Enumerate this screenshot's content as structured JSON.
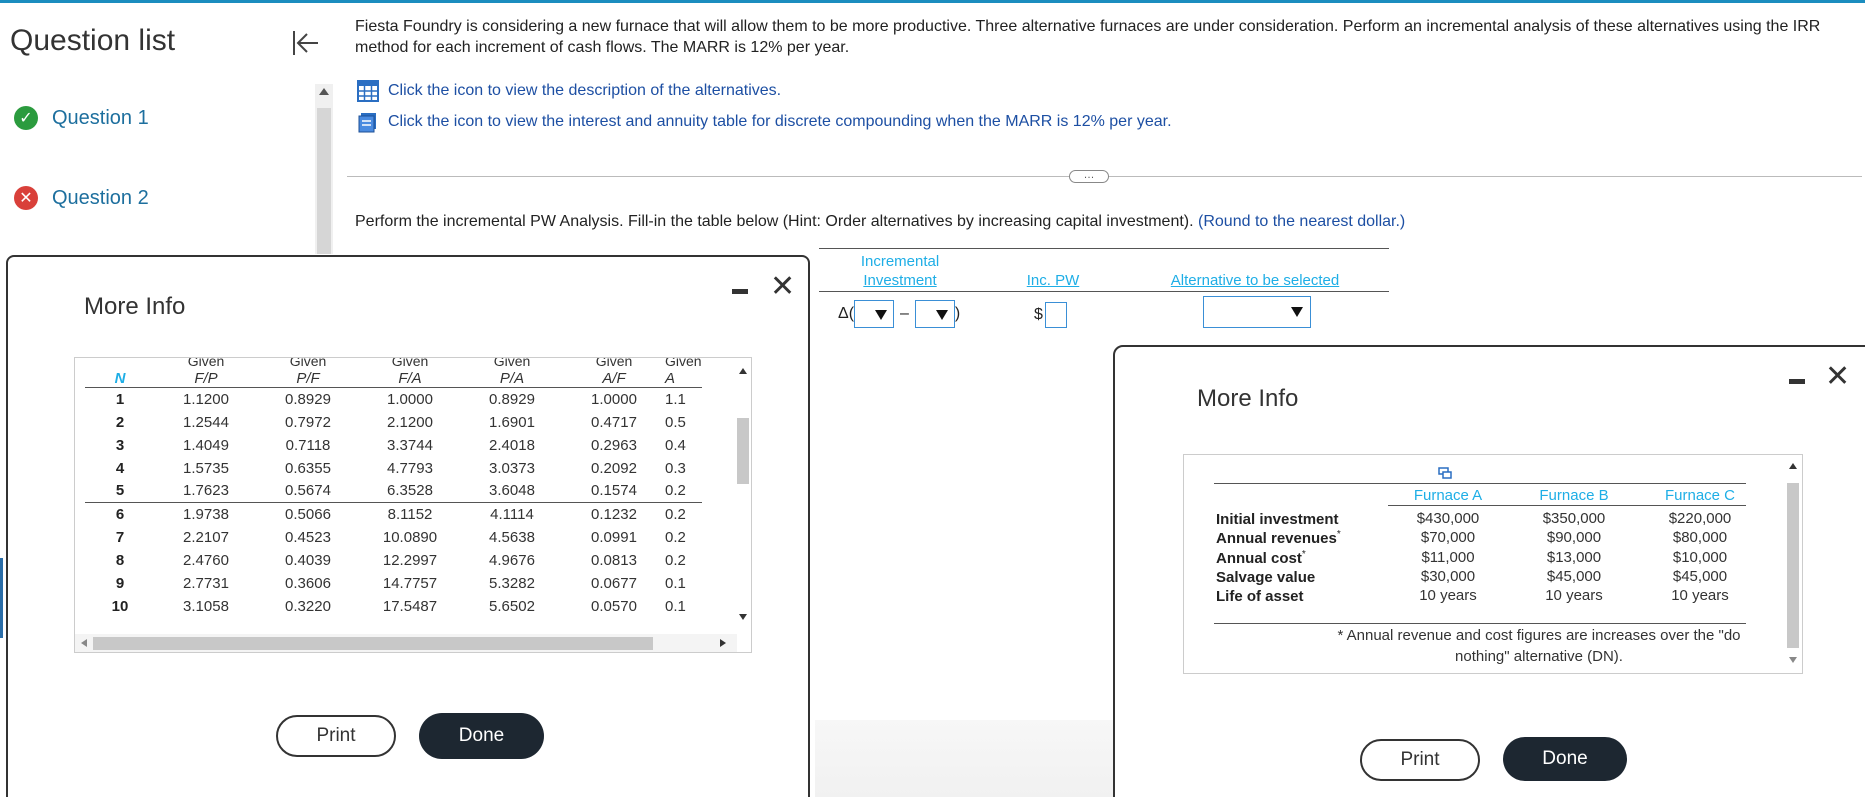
{
  "sidebar": {
    "title": "Question list",
    "questions": [
      {
        "label": "Question 1",
        "status": "correct"
      },
      {
        "label": "Question 2",
        "status": "incorrect"
      }
    ]
  },
  "problem_text": "Fiesta Foundry is considering a new furnace that will allow them to be more productive. Three alternative furnaces are under consideration. Perform an incremental analysis of these alternatives using the IRR method for each increment of cash flows. The MARR is 12% per year.",
  "links": {
    "alternatives": "Click the icon to view the description of the alternatives.",
    "interest_table": "Click the icon to view the interest and annuity table for discrete compounding when the MARR is 12% per year."
  },
  "more_pill": "…",
  "instruction": {
    "text": "Perform the incremental PW Analysis. Fill-in the table below (Hint: Order alternatives by increasing capital investment).",
    "hint": "(Round to the nearest dollar.)"
  },
  "answer_table": {
    "col_incremental_1": "Incremental",
    "col_incremental_2": "Investment",
    "col_inc_pw": "Inc. PW",
    "col_alternative": "Alternative to be selected",
    "delta_prefix": "Δ(",
    "delta_dash": "–",
    "delta_suffix": ")",
    "dollar": "$"
  },
  "factor_modal": {
    "title": "More Info",
    "given_label": "Given",
    "columns": [
      "N",
      "F/P",
      "P/F",
      "F/A",
      "P/A",
      "A/F",
      "A"
    ],
    "rows": [
      [
        "1",
        "1.1200",
        "0.8929",
        "1.0000",
        "0.8929",
        "1.0000",
        "1.1"
      ],
      [
        "2",
        "1.2544",
        "0.7972",
        "2.1200",
        "1.6901",
        "0.4717",
        "0.5"
      ],
      [
        "3",
        "1.4049",
        "0.7118",
        "3.3744",
        "2.4018",
        "0.2963",
        "0.4"
      ],
      [
        "4",
        "1.5735",
        "0.6355",
        "4.7793",
        "3.0373",
        "0.2092",
        "0.3"
      ],
      [
        "5",
        "1.7623",
        "0.5674",
        "6.3528",
        "3.6048",
        "0.1574",
        "0.2"
      ],
      [
        "6",
        "1.9738",
        "0.5066",
        "8.1152",
        "4.1114",
        "0.1232",
        "0.2"
      ],
      [
        "7",
        "2.2107",
        "0.4523",
        "10.0890",
        "4.5638",
        "0.0991",
        "0.2"
      ],
      [
        "8",
        "2.4760",
        "0.4039",
        "12.2997",
        "4.9676",
        "0.0813",
        "0.2"
      ],
      [
        "9",
        "2.7731",
        "0.3606",
        "14.7757",
        "5.3282",
        "0.0677",
        "0.1"
      ],
      [
        "10",
        "3.1058",
        "0.3220",
        "17.5487",
        "5.6502",
        "0.0570",
        "0.1"
      ]
    ],
    "print": "Print",
    "done": "Done"
  },
  "alternatives_modal": {
    "title": "More Info",
    "headers": [
      "Furnace A",
      "Furnace B",
      "Furnace C"
    ],
    "rows": [
      {
        "label": "Initial investment",
        "star": "",
        "values": [
          "$430,000",
          "$350,000",
          "$220,000"
        ]
      },
      {
        "label": "Annual revenues",
        "star": "*",
        "values": [
          "$70,000",
          "$90,000",
          "$80,000"
        ]
      },
      {
        "label": "Annual cost",
        "star": "*",
        "values": [
          "$11,000",
          "$13,000",
          "$10,000"
        ]
      },
      {
        "label": "Salvage value",
        "star": "",
        "values": [
          "$30,000",
          "$45,000",
          "$45,000"
        ]
      },
      {
        "label": "Life of asset",
        "star": "",
        "values": [
          "10 years",
          "10 years",
          "10 years"
        ]
      }
    ],
    "note": "* Annual revenue and cost figures are increases over the \"do nothing\" alternative (DN).",
    "print": "Print",
    "done": "Done"
  },
  "colors": {
    "accent": "#1eaee6",
    "link": "#1d4fa3",
    "correct": "#2b9b3e",
    "incorrect": "#d9403a",
    "done_button": "#1d2731"
  }
}
